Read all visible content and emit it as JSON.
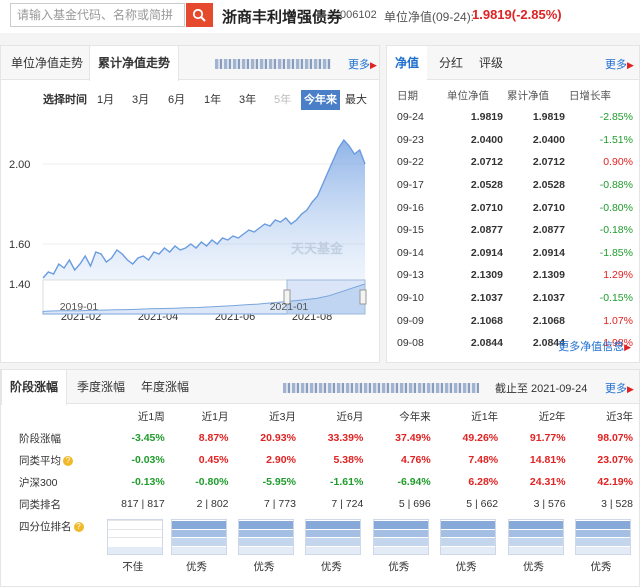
{
  "header": {
    "search_placeholder": "请输入基金代码、名称或简拼",
    "fund_name": "浙商丰利增强债券",
    "fund_code": "006102",
    "nav_label": "单位净值(09-24):",
    "nav_value": "1.9819(-2.85%)"
  },
  "chart_panel": {
    "tabs": [
      "单位净值走势",
      "累计净值走势"
    ],
    "active_tab": "累计净值走势",
    "more_label": "更多",
    "range_label": "选择时间",
    "ranges": [
      "1月",
      "3月",
      "6月",
      "1年",
      "3年",
      "5年",
      "今年来",
      "最大"
    ],
    "range_disabled": "5年",
    "range_selected": "今年来",
    "watermark": "天天基金"
  },
  "chart_data": {
    "type": "area",
    "title": "",
    "xlabel": "",
    "ylabel": "",
    "ylim": [
      1.3,
      2.2
    ],
    "yticks": [
      "2.00",
      "1.60",
      "1.40"
    ],
    "xticks": [
      "2021-02",
      "2021-04",
      "2021-06",
      "2021-08"
    ],
    "line_color": "#6a9be0",
    "fill_color": "#c9dcf5",
    "series": [
      {
        "values": [
          1.43,
          1.46,
          1.45,
          1.5,
          1.48,
          1.52,
          1.47,
          1.5,
          1.54,
          1.49,
          1.56,
          1.55,
          1.51,
          1.53,
          1.57,
          1.55,
          1.52,
          1.5,
          1.53,
          1.54,
          1.52,
          1.56,
          1.55,
          1.58,
          1.56,
          1.59,
          1.57,
          1.58,
          1.6,
          1.58,
          1.61,
          1.59,
          1.62,
          1.6,
          1.63,
          1.62,
          1.64,
          1.63,
          1.65,
          1.67,
          1.66,
          1.68,
          1.7,
          1.69,
          1.72,
          1.71,
          1.73,
          1.7,
          1.72,
          1.75,
          1.77,
          1.81,
          1.84,
          1.9,
          1.96,
          2.02,
          2.08,
          2.12,
          2.09,
          2.05,
          2.07,
          2.0
        ]
      }
    ],
    "navigator": {
      "xticks": [
        "2019-01",
        "2021-01"
      ],
      "values": [
        1.0,
        1.02,
        1.03,
        1.02,
        1.04,
        1.05,
        1.06,
        1.07,
        1.08,
        1.1,
        1.11,
        1.12,
        1.14,
        1.15,
        1.17,
        1.2,
        1.22,
        1.25,
        1.28,
        1.32,
        1.36,
        1.4,
        1.45,
        1.5,
        1.6,
        1.75,
        1.9,
        2.05
      ]
    }
  },
  "nav_panel": {
    "tabs": [
      "净值",
      "分红",
      "评级"
    ],
    "active_tab": "净值",
    "more_label": "更多",
    "columns": [
      "日期",
      "单位净值",
      "累计净值",
      "日增长率"
    ],
    "rows": [
      {
        "date": "09-24",
        "unit": "1.9819",
        "acc": "1.9819",
        "rate": "-2.85%",
        "sign": "neg"
      },
      {
        "date": "09-23",
        "unit": "2.0400",
        "acc": "2.0400",
        "rate": "-1.51%",
        "sign": "neg"
      },
      {
        "date": "09-22",
        "unit": "2.0712",
        "acc": "2.0712",
        "rate": "0.90%",
        "sign": "pos"
      },
      {
        "date": "09-17",
        "unit": "2.0528",
        "acc": "2.0528",
        "rate": "-0.88%",
        "sign": "neg"
      },
      {
        "date": "09-16",
        "unit": "2.0710",
        "acc": "2.0710",
        "rate": "-0.80%",
        "sign": "neg"
      },
      {
        "date": "09-15",
        "unit": "2.0877",
        "acc": "2.0877",
        "rate": "-0.18%",
        "sign": "neg"
      },
      {
        "date": "09-14",
        "unit": "2.0914",
        "acc": "2.0914",
        "rate": "-1.85%",
        "sign": "neg"
      },
      {
        "date": "09-13",
        "unit": "2.1309",
        "acc": "2.1309",
        "rate": "1.29%",
        "sign": "pos"
      },
      {
        "date": "09-10",
        "unit": "2.1037",
        "acc": "2.1037",
        "rate": "-0.15%",
        "sign": "neg"
      },
      {
        "date": "09-09",
        "unit": "2.1068",
        "acc": "2.1068",
        "rate": "1.07%",
        "sign": "pos"
      },
      {
        "date": "09-08",
        "unit": "2.0844",
        "acc": "2.0844",
        "rate": "1.98%",
        "sign": "pos"
      }
    ],
    "more_nav_label": "更多净值信息"
  },
  "perf_panel": {
    "tabs": [
      "阶段涨幅",
      "季度涨幅",
      "年度涨幅"
    ],
    "active_tab": "阶段涨幅",
    "as_of": "截止至 2021-09-24",
    "more_label": "更多",
    "periods": [
      "近1周",
      "近1月",
      "近3月",
      "近6月",
      "今年来",
      "近1年",
      "近2年",
      "近3年"
    ],
    "rows": [
      {
        "label": "阶段涨幅",
        "info": false,
        "values": [
          "-3.45%",
          "8.87%",
          "20.93%",
          "33.39%",
          "37.49%",
          "49.26%",
          "91.77%",
          "98.07%"
        ]
      },
      {
        "label": "同类平均",
        "info": true,
        "values": [
          "-0.03%",
          "0.45%",
          "2.90%",
          "5.38%",
          "4.76%",
          "7.48%",
          "14.81%",
          "23.07%"
        ]
      },
      {
        "label": "沪深300",
        "info": false,
        "values": [
          "-0.13%",
          "-0.80%",
          "-5.95%",
          "-1.61%",
          "-6.94%",
          "6.28%",
          "24.31%",
          "42.19%"
        ]
      }
    ],
    "rank_label": "同类排名",
    "ranks": [
      "817 | 817",
      "2 | 802",
      "7 | 773",
      "7 | 724",
      "5 | 696",
      "5 | 662",
      "3 | 576",
      "3 | 528"
    ],
    "quartile_label": "四分位排名",
    "quartiles": [
      {
        "text": "不佳",
        "level": 0.25
      },
      {
        "text": "优秀",
        "level": 1.0
      },
      {
        "text": "优秀",
        "level": 1.0
      },
      {
        "text": "优秀",
        "level": 1.0
      },
      {
        "text": "优秀",
        "level": 1.0
      },
      {
        "text": "优秀",
        "level": 1.0
      },
      {
        "text": "优秀",
        "level": 1.0
      },
      {
        "text": "优秀",
        "level": 1.0
      }
    ]
  }
}
